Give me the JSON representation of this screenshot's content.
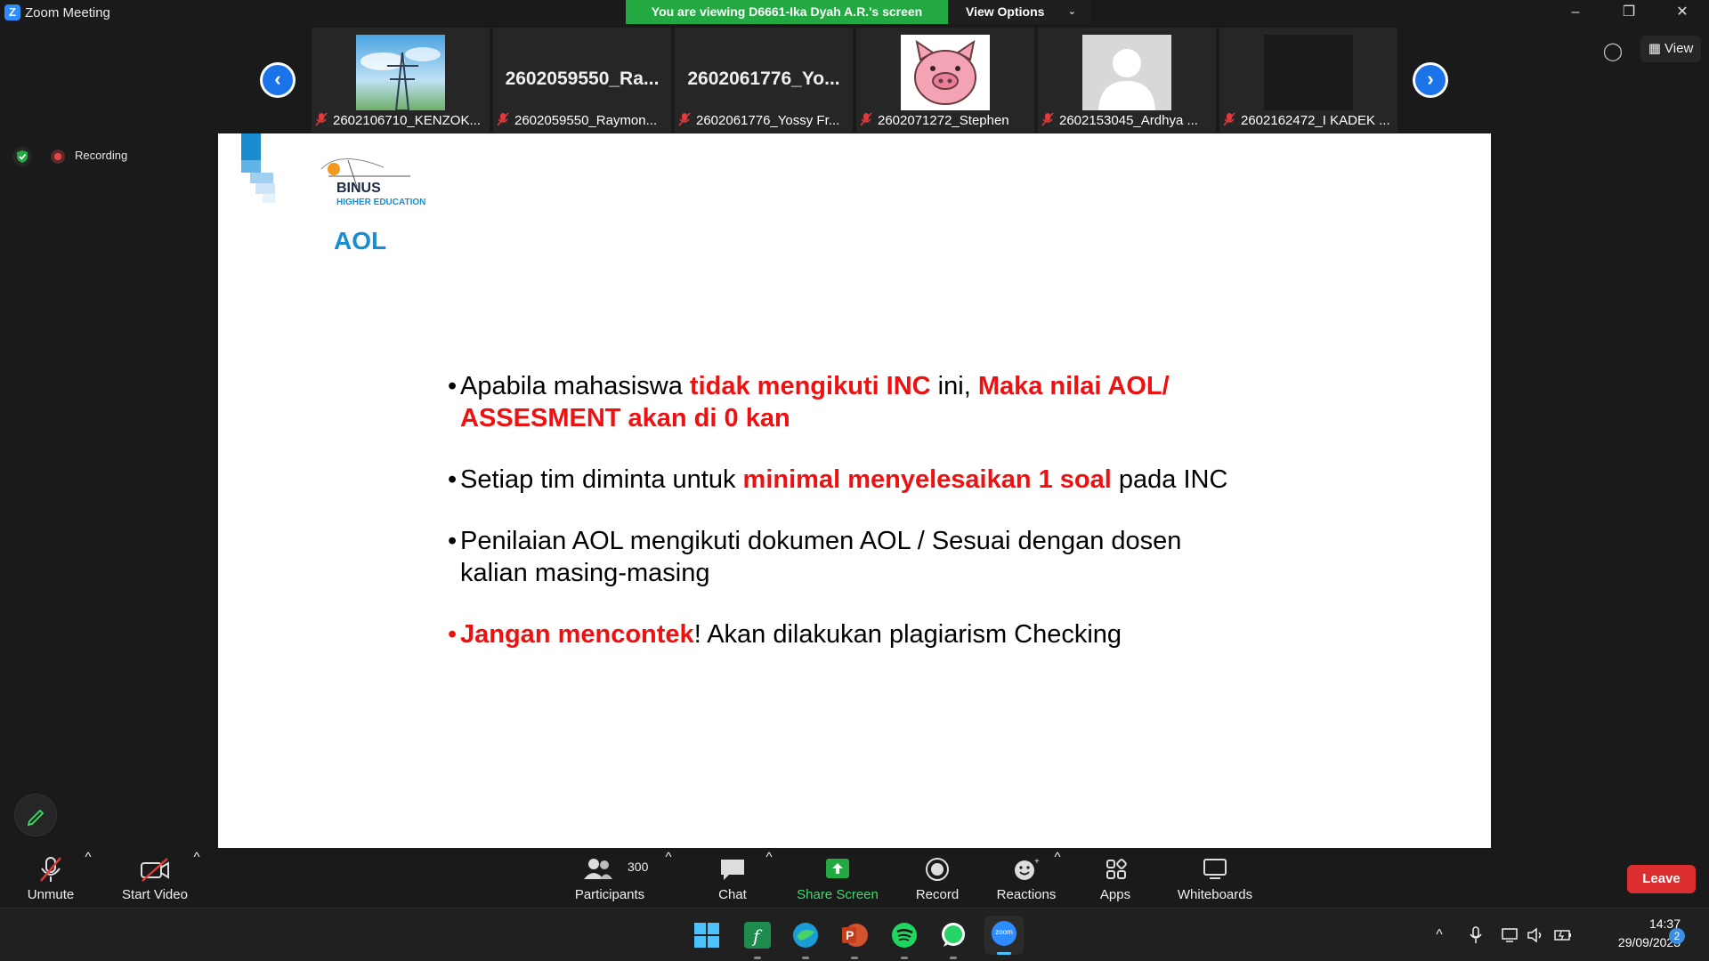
{
  "window": {
    "title": "Zoom Meeting",
    "app_icon": "Z",
    "share_banner": "You are viewing D6661-Ika Dyah A.R.'s screen",
    "view_options": "View Options",
    "minimize_glyph": "–",
    "restore_glyph": "❐",
    "close_glyph": "✕"
  },
  "gallery": {
    "prev_glyph": "‹",
    "next_glyph": "›",
    "view_label": "View",
    "tiles": [
      {
        "label": "2602106710_KENZOK...",
        "big": ""
      },
      {
        "label": "2602059550_Raymon...",
        "big": "2602059550_Ra..."
      },
      {
        "label": "2602061776_Yossy Fr...",
        "big": "2602061776_Yo..."
      },
      {
        "label": "2602071272_Stephen",
        "big": ""
      },
      {
        "label": "2602153045_Ardhya ...",
        "big": ""
      },
      {
        "label": "2602162472_I KADEK ...",
        "big": ""
      }
    ]
  },
  "recording": {
    "label": "Recording"
  },
  "slide": {
    "logo_text": "BINUS",
    "logo_sub": "HIGHER EDUCATION",
    "title": "AOL",
    "bullets": [
      {
        "parts": [
          {
            "t": "Apabila mahasiswa ",
            "red": false
          },
          {
            "t": "tidak mengikuti INC",
            "red": true
          },
          {
            "t": " ini, ",
            "red": false
          },
          {
            "t": "Maka  nilai AOL/ ASSESMENT akan di 0 kan",
            "red": true
          }
        ],
        "dot_red": false
      },
      {
        "parts": [
          {
            "t": "Setiap tim diminta untuk ",
            "red": false
          },
          {
            "t": "minimal menyelesaikan 1 soal",
            "red": true
          },
          {
            "t": " pada INC",
            "red": false
          }
        ],
        "dot_red": false
      },
      {
        "parts": [
          {
            "t": "Penilaian AOL mengikuti dokumen AOL / Sesuai dengan dosen kalian masing-masing",
            "red": false
          }
        ],
        "dot_red": false
      },
      {
        "parts": [
          {
            "t": "Jangan mencontek",
            "red": true
          },
          {
            "t": "! Akan dilakukan plagiarism Checking",
            "red": false
          }
        ],
        "dot_red": true
      }
    ]
  },
  "toolbar": {
    "unmute": "Unmute",
    "start_video": "Start Video",
    "participants": "Participants",
    "participants_count": "300",
    "chat": "Chat",
    "share_screen": "Share Screen",
    "record": "Record",
    "reactions": "Reactions",
    "apps": "Apps",
    "whiteboards": "Whiteboards",
    "leave": "Leave",
    "caret": "^"
  },
  "taskbar": {
    "time": "14:37",
    "date": "29/09/2023",
    "notifications": "2",
    "tray_chevron": "^",
    "apps": [
      "start",
      "fiddler",
      "edge",
      "powerpoint",
      "spotify",
      "whatsapp",
      "zoom"
    ],
    "zoom_label": "zoom",
    "ppt_label": "P"
  },
  "colors": {
    "share_green": "#23a942",
    "accent_blue": "#1a73e8",
    "slide_red": "#ee1111",
    "slide_title_blue": "#1a8dd0",
    "leave_red": "#dc2e2e"
  }
}
